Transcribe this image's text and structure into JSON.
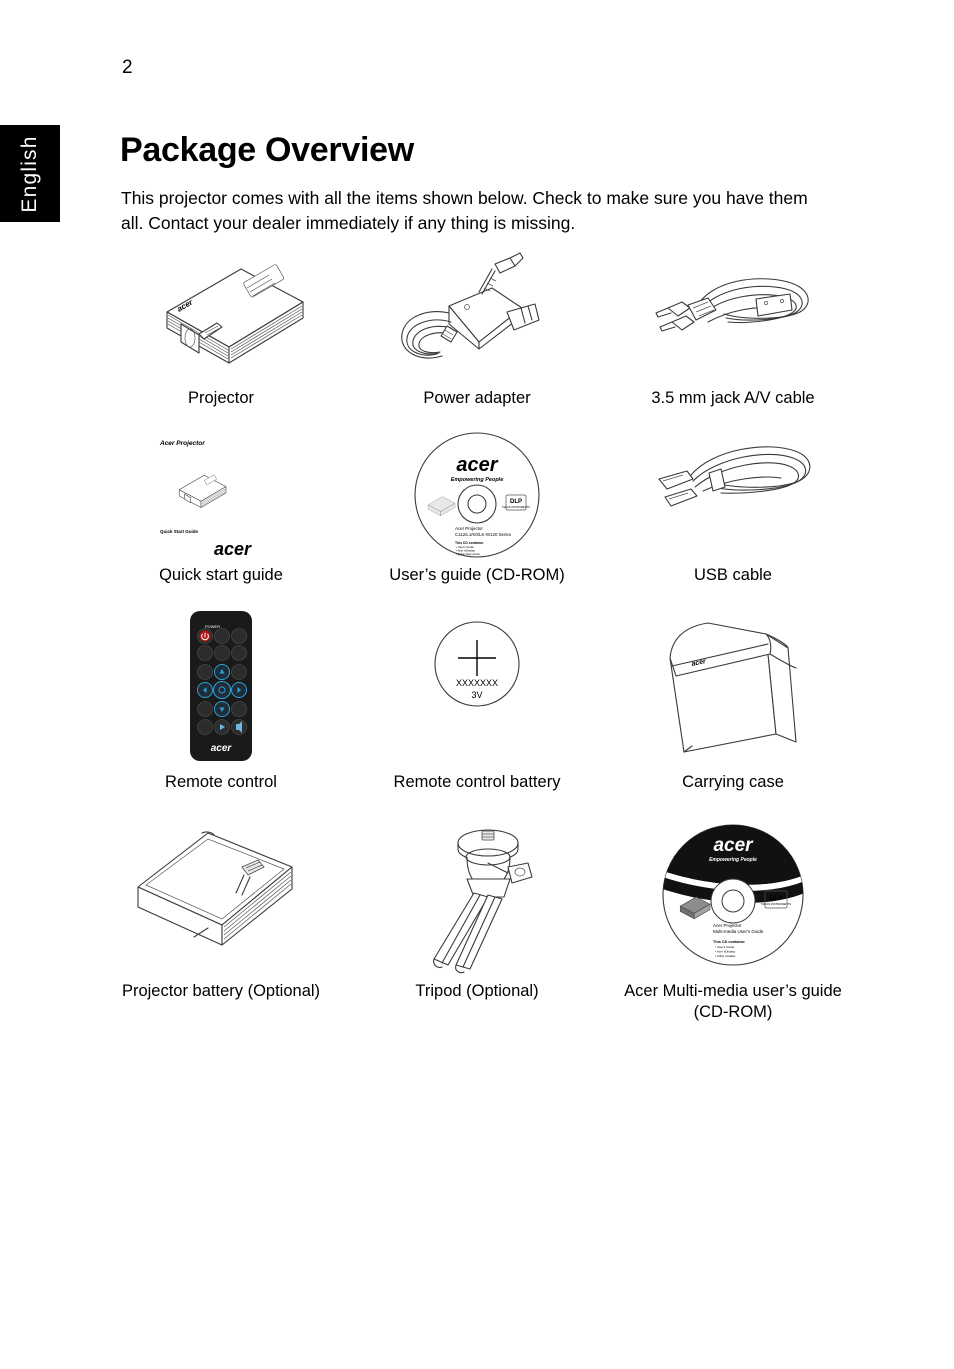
{
  "page": {
    "number": "2",
    "language_tab": "English",
    "title": "Package Overview",
    "intro": "This projector comes with all the items shown below. Check to make sure you have them all. Contact your dealer immediately if any thing is missing."
  },
  "items": [
    {
      "id": "projector",
      "caption": "Projector",
      "icon": "projector-illustration"
    },
    {
      "id": "power-adapter",
      "caption": "Power adapter",
      "icon": "power-adapter-illustration"
    },
    {
      "id": "av-cable",
      "caption": "3.5 mm jack A/V cable",
      "icon": "av-cable-illustration"
    },
    {
      "id": "quick-start",
      "caption": "Quick start guide",
      "icon": "quick-start-guide-illustration"
    },
    {
      "id": "users-guide-cd",
      "caption": "User’s guide (CD-ROM)",
      "icon": "cd-rom-illustration"
    },
    {
      "id": "usb-cable",
      "caption": "USB cable",
      "icon": "usb-cable-illustration"
    },
    {
      "id": "remote-control",
      "caption": "Remote control",
      "icon": "remote-control-illustration"
    },
    {
      "id": "remote-battery",
      "caption": "Remote control battery",
      "icon": "coin-battery-illustration"
    },
    {
      "id": "carrying-case",
      "caption": "Carrying case",
      "icon": "carrying-case-illustration"
    },
    {
      "id": "projector-battery",
      "caption": "Projector battery (Optional)",
      "icon": "projector-battery-illustration"
    },
    {
      "id": "tripod",
      "caption": "Tripod (Optional)",
      "icon": "tripod-illustration"
    },
    {
      "id": "multimedia-cd",
      "caption": "Acer Multi-media user’s guide (CD-ROM)",
      "icon": "multimedia-cd-illustration"
    }
  ],
  "artwork_text": {
    "quick_start_guide": {
      "header": "Acer Projector",
      "footer": "Quick Start Guide",
      "logo": "acer"
    },
    "users_guide_cd": {
      "logo": "acer",
      "tagline": "Empowering People",
      "line1": "Acer Projector",
      "line2": "C112/L1/K0/LK-W120 Series",
      "note_header": "This CD contains:",
      "badge": "DLP"
    },
    "coin_battery": {
      "model": "XXXXXXX",
      "voltage": "3V",
      "polarity": "+"
    },
    "carrying_case": {
      "logo": "acer"
    },
    "remote_control": {
      "logo": "acer",
      "power_label": "POWER"
    },
    "multimedia_cd": {
      "logo": "acer",
      "tagline": "Empowering People",
      "line1": "Acer Projector",
      "line2": "Multi-media User's Guide",
      "note_header": "This CD contains:",
      "badge": "DLP"
    }
  },
  "colors": {
    "page_background": "#ffffff",
    "text": "#000000",
    "tab_background": "#000000",
    "tab_text": "#ffffff",
    "line_art": "#3a3a3a",
    "remote_body": "#1a1a1a",
    "remote_power_button": "#b11616",
    "remote_nav_accent": "#2f9fd8"
  }
}
